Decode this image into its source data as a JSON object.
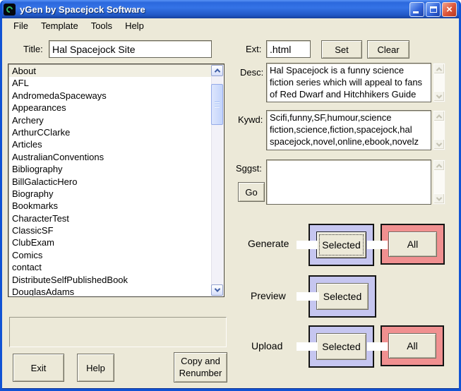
{
  "window": {
    "title": "yGen by Spacejock Software"
  },
  "icons": {
    "close_glyph": "×"
  },
  "menu": {
    "items": [
      "File",
      "Template",
      "Tools",
      "Help"
    ]
  },
  "form": {
    "title": {
      "label": "Title:",
      "value": "Hal Spacejock Site"
    },
    "ext": {
      "label": "Ext:",
      "value": ".html"
    },
    "buttons": {
      "set": "Set",
      "clear": "Clear",
      "go": "Go"
    },
    "desc": {
      "label": "Desc:",
      "value": "Hal Spacejock is a funny science fiction series which will appeal to fans of Red Dwarf and Hitchhikers Guide"
    },
    "kywd": {
      "label": "Kywd:",
      "value": "Scifi,funny,SF,humour,science fiction,science,fiction,spacejock,hal spacejock,novel,online,ebook,novelz"
    },
    "sggst": {
      "label": "Sggst:",
      "value": ""
    }
  },
  "page_list": {
    "selected_item": "About",
    "items": [
      "About",
      "AFL",
      "AndromedaSpaceways",
      "Appearances",
      "Archery",
      "ArthurCClarke",
      "Articles",
      "AustralianConventions",
      "Bibliography",
      "BillGalacticHero",
      "Biography",
      "Bookmarks",
      "CharacterTest",
      "ClassicSF",
      "ClubExam",
      "Comics",
      "contact",
      "DistributeSelfPublishedBook",
      "DouglasAdams"
    ]
  },
  "actions": {
    "generate": {
      "label": "Generate",
      "selected": "Selected",
      "all": "All"
    },
    "preview": {
      "label": "Preview",
      "selected": "Selected"
    },
    "upload": {
      "label": "Upload",
      "selected": "Selected",
      "all": "All"
    }
  },
  "footer": {
    "exit": "Exit",
    "help": "Help",
    "copy_renumber": "Copy and Renumber"
  },
  "colors": {
    "window_bg": "#ece9d8",
    "titlebar_blue": "#2b68dd",
    "window_border_blue": "#1153d4",
    "frame_blue": "#c6c6f0",
    "frame_red": "#f09090",
    "list_selection": "#f1efe2"
  }
}
